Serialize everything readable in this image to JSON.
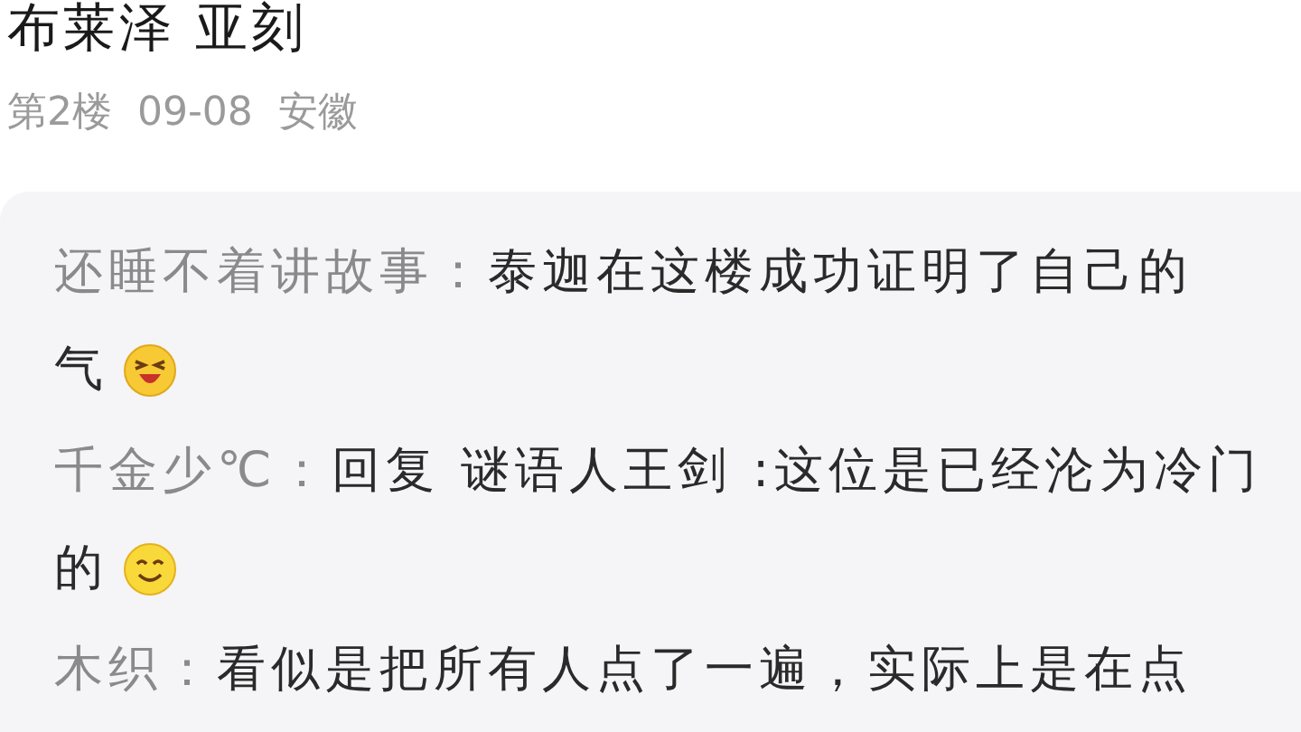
{
  "post": {
    "author_line": "布莱泽 亚刻",
    "floor": "第2楼",
    "date": "09-08",
    "location": "安徽"
  },
  "replies": [
    {
      "author": "还睡不着讲故事：",
      "lines": [
        "泰迦在这楼成功证明了自己的",
        "气"
      ],
      "kind": "laughing"
    },
    {
      "author": "千金少℃：",
      "lines": [
        "回复 谜语人王剑 :这位是已经沦为冷门",
        "的"
      ],
      "kind": "smile"
    },
    {
      "author": "木织：",
      "lines": [
        "看似是把所有人点了一遍，实际上是在点"
      ],
      "kind": "plain"
    }
  ]
}
